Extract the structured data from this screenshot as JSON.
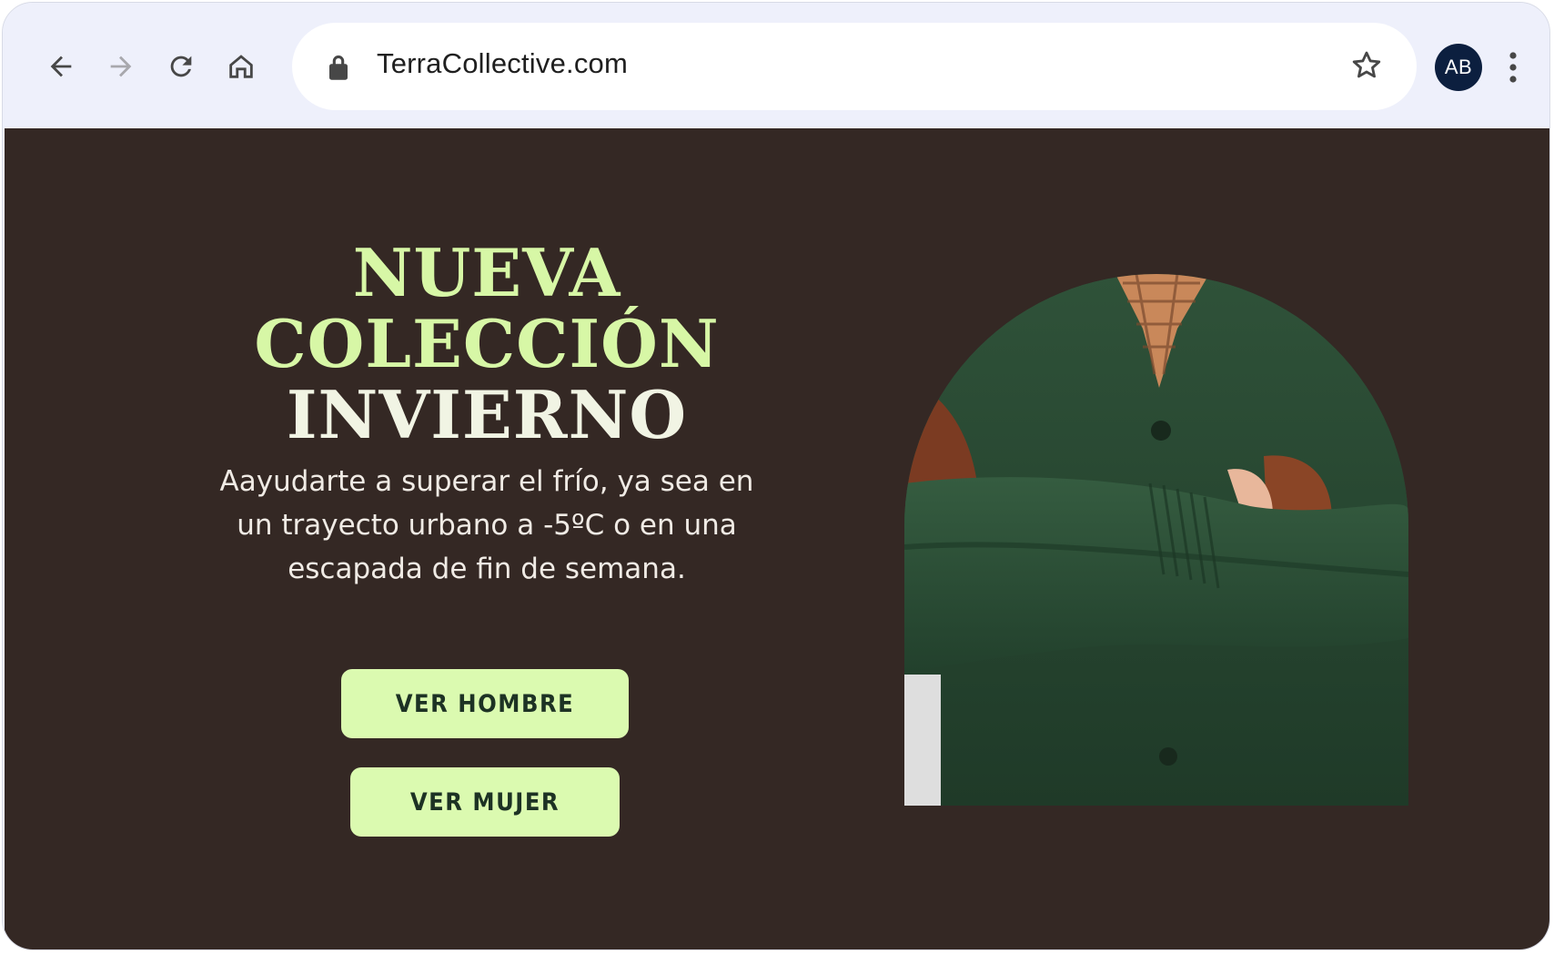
{
  "browser": {
    "url": "TerraCollective.com",
    "avatar_initials": "AB",
    "icons": [
      "back-arrow-icon",
      "forward-arrow-icon",
      "reload-icon",
      "home-icon",
      "lock-icon",
      "star-icon",
      "more-vert-icon"
    ]
  },
  "hero": {
    "title_line1": "NUEVA",
    "title_line2": "COLECCIÓN",
    "title_line3": "INVIERNO",
    "subtitle": "Aayudarte a superar el frío, ya sea en un trayecto urbano a -5ºC o en una escapada de fin de semana.",
    "cta_men": "VER HOMBRE",
    "cta_women": "VER MUJER"
  },
  "colors": {
    "page_background": "#342824",
    "title_accent": "#d7f7a6",
    "title_light": "#f1f4e4",
    "button_background": "#dbfab0",
    "button_text": "#1d3224",
    "browser_chrome": "#eef0fb",
    "avatar_background": "#0c1f3f"
  }
}
